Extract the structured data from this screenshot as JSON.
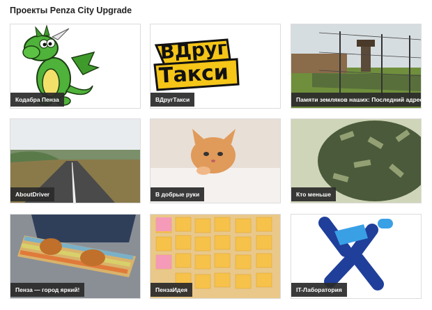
{
  "page": {
    "title": "Проекты Penza City Upgrade"
  },
  "projects": [
    {
      "label": "Кодабра Пенза",
      "icon": "green-dragon-illustration"
    },
    {
      "label": "ВДругТакси",
      "logo_text": [
        "ВДруг",
        "Такси"
      ],
      "icon": "taxi-logo"
    },
    {
      "label": "Памяти земляков наших: Последний адрес",
      "icon": "camp-fence-photo"
    },
    {
      "label": "AboutDriver",
      "icon": "road-photo"
    },
    {
      "label": "В добрые руки",
      "icon": "kitten-photo"
    },
    {
      "label": "Кто меньше",
      "icon": "money-pile-photo"
    },
    {
      "label": "Пенза — город яркий!",
      "icon": "skateboard-photo"
    },
    {
      "label": "ПензаИдея",
      "icon": "sticky-notes-photo"
    },
    {
      "label": "IT-Лаборатория",
      "icon": "it-lab-logo"
    }
  ]
}
